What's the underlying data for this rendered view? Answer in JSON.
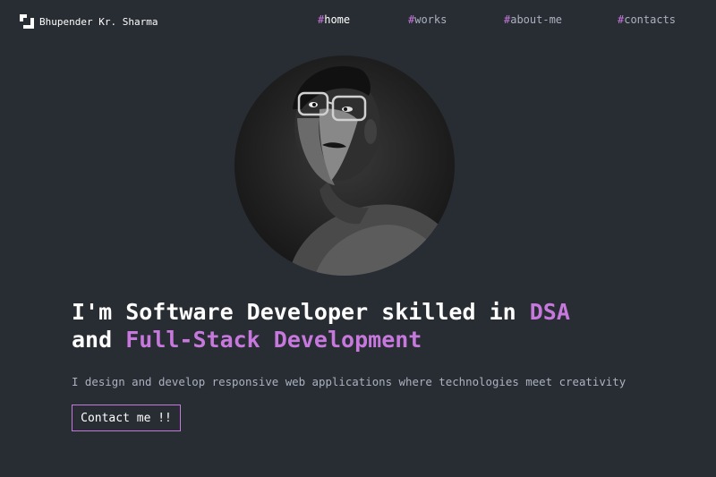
{
  "header": {
    "logo_text": "Bhupender Kr. Sharma",
    "nav": [
      {
        "hash": "#",
        "label": "home",
        "active": true
      },
      {
        "hash": "#",
        "label": "works",
        "active": false
      },
      {
        "hash": "#",
        "label": "about-me",
        "active": false
      },
      {
        "hash": "#",
        "label": "contacts",
        "active": false
      }
    ]
  },
  "hero": {
    "headline": {
      "part1": "I'm Software Developer skilled in ",
      "accent1": "DSA",
      "part2": "and ",
      "accent2": "Full-Stack Development"
    },
    "subtitle": "I design and develop responsive web applications where technologies meet creativity",
    "cta_label": "Contact me !!"
  },
  "colors": {
    "background": "#282c33",
    "accent": "#c778dd",
    "text_primary": "#ffffff",
    "text_secondary": "#abb2bf"
  },
  "icons": {
    "logo": "logo-mark-icon"
  }
}
